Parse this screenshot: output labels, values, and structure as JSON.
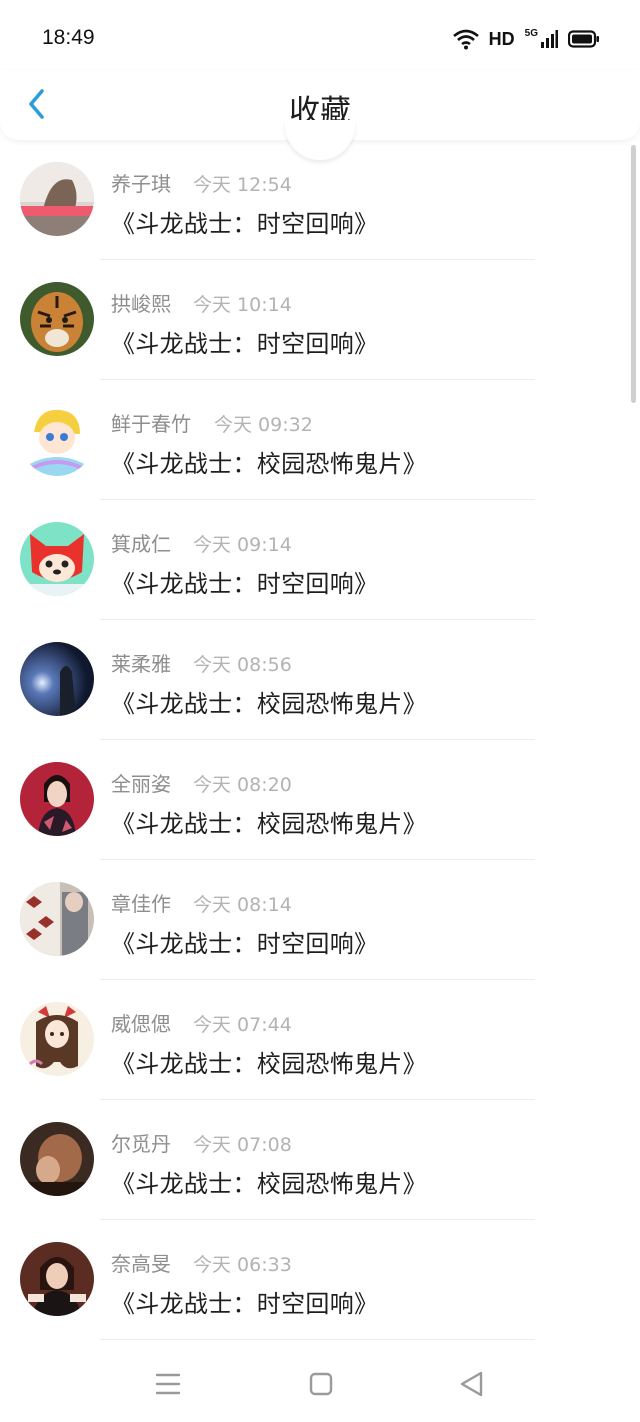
{
  "status_bar": {
    "time": "18:49",
    "hd": "HD",
    "network": "5G"
  },
  "header": {
    "title": "收藏",
    "back_icon": "chevron-left-icon",
    "accent": "#2d9cdb"
  },
  "items": [
    {
      "name": "养子琪",
      "time": "今天 12:54",
      "title": "《斗龙战士：时空回响》"
    },
    {
      "name": "拱峻熙",
      "time": "今天 10:14",
      "title": "《斗龙战士：时空回响》"
    },
    {
      "name": "鲜于春竹",
      "time": "今天 09:32",
      "title": "《斗龙战士：校园恐怖鬼片》"
    },
    {
      "name": "箕成仁",
      "time": "今天 09:14",
      "title": "《斗龙战士：时空回响》"
    },
    {
      "name": "莱柔雅",
      "time": "今天 08:56",
      "title": "《斗龙战士：校园恐怖鬼片》"
    },
    {
      "name": "全丽姿",
      "time": "今天 08:20",
      "title": "《斗龙战士：校园恐怖鬼片》"
    },
    {
      "name": "章佳作",
      "time": "今天 08:14",
      "title": "《斗龙战士：时空回响》"
    },
    {
      "name": "威偲偲",
      "time": "今天 07:44",
      "title": "《斗龙战士：校园恐怖鬼片》"
    },
    {
      "name": "尔觅丹",
      "time": "今天 07:08",
      "title": "《斗龙战士：校园恐怖鬼片》"
    },
    {
      "name": "奈高旻",
      "time": "今天 06:33",
      "title": "《斗龙战士：时空回响》"
    }
  ],
  "avatar_images": [
    "photo-avatar",
    "tiger-avatar",
    "cartoon-girl-avatar",
    "cartoon-fox-avatar",
    "night-sky-avatar",
    "woman-portrait-avatar",
    "photo-avatar",
    "anime-girl-avatar",
    "photo-avatar",
    "photo-avatar"
  ],
  "navbar": {
    "menu_icon": "menu-icon",
    "home_icon": "square-home-icon",
    "back_icon": "triangle-back-icon"
  }
}
